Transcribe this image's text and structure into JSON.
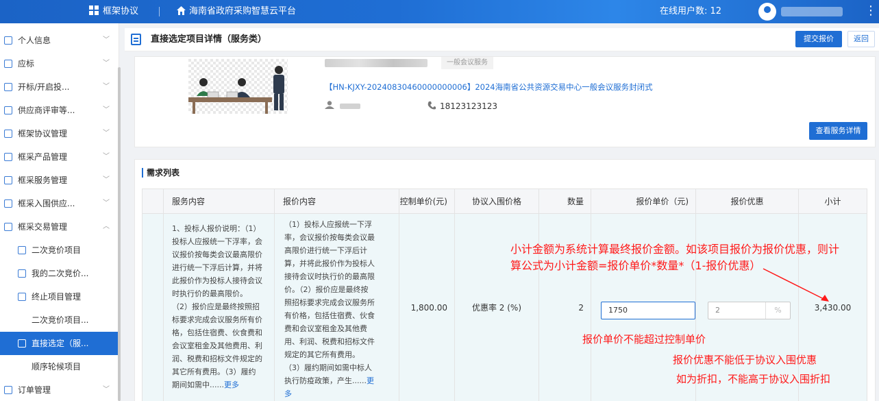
{
  "topbar": {
    "module": "框架协议",
    "platform": "海南省政府采购智慧云平台",
    "online_users": "在线用户数: 12"
  },
  "sidebar": {
    "items": [
      {
        "label": "个人信息"
      },
      {
        "label": "应标"
      },
      {
        "label": "开标/开启投..."
      },
      {
        "label": "供应商评审等..."
      },
      {
        "label": "框架协议管理"
      },
      {
        "label": "框采产品管理"
      },
      {
        "label": "框采服务管理"
      },
      {
        "label": "框采入围供应..."
      },
      {
        "label": "框采交易管理"
      },
      {
        "label": "二次竞价项目"
      },
      {
        "label": "我的二次竞价..."
      },
      {
        "label": "终止项目管理"
      },
      {
        "label": "二次竞价项目..."
      },
      {
        "label": "直接选定（服..."
      },
      {
        "label": "顺序轮候项目"
      },
      {
        "label": "订单管理"
      }
    ]
  },
  "header": {
    "title": "直接选定项目详情（服务类）",
    "submit_label": "提交报价",
    "back_label": "返回"
  },
  "service": {
    "category_badge": "一般会议服务",
    "project_link": "【HN-KJXY-20240830460000000006】2024海南省公共资源交易中心一般会议服务封闭式",
    "phone": "18123123123",
    "view_detail_label": "查看服务详情"
  },
  "requirements": {
    "section_title": "需求列表",
    "columns": [
      "服务内容",
      "报价内容",
      "控制单价(元)",
      "协议入围价格",
      "数量",
      "报价单价（元)",
      "报价优惠",
      "小计"
    ],
    "row": {
      "service_content_lines": [
        "1、投标人报价说明：（1）",
        "投标人应报统一下浮率，会",
        "议报价按每类会议最高限价",
        "进行统一下浮后计算，并将",
        "此报价作为投标人接待会议",
        "时执行价的最高限价。",
        "（2）报价应是最终按照招",
        "标要求完成会议服务所有价",
        "格，包括住宿费、伙食费和",
        "会议室租金及其他费用、利",
        "润、税费和招标文件规定的",
        "其它所有费用。（3）履约",
        "期间如需中......"
      ],
      "service_more": "更多",
      "quote_content_lines": [
        "（1）投标人应报统一下浮",
        "率，会议报价按每类会议最",
        "高限价进行统一下浮后计",
        "算，并将此报价作为投标人",
        "接待会议时执行价的最高限",
        "价。（2）报价应是最终按",
        "照招标要求完成会议服务所",
        "有价格，包括住宿费、伙食",
        "费和会议室租金及其他费",
        "用、利润、税费和招标文件",
        "规定的其它所有费用。",
        "（3）履约期间如需中标人",
        "执行防疫政策，产生......"
      ],
      "quote_more_a": "更",
      "quote_more_b": "多",
      "control_price": "1,800.00",
      "agreement_price": "优惠率 2 (%)",
      "quantity": "2",
      "unit_price_input": "1750",
      "discount_input": "2",
      "discount_unit": "%",
      "subtotal": "3,430.00"
    }
  },
  "annotations": {
    "subtotal_line1": "小计金额为系统计算最终报价金额。如该项目报价为报价优惠，则计",
    "subtotal_line2": "算公式为小计金额=报价单价*数量*（1-报价优惠）",
    "unit_price_note": "报价单价不能超过控制单价",
    "discount_note1": "报价优惠不能低于协议入围优惠",
    "discount_note2": "如为折扣，不能高于协议入围折扣",
    "color": "#ff1a1a"
  },
  "colors": {
    "brand": "#1f6ed4",
    "row_bg": "#eef7f9"
  }
}
